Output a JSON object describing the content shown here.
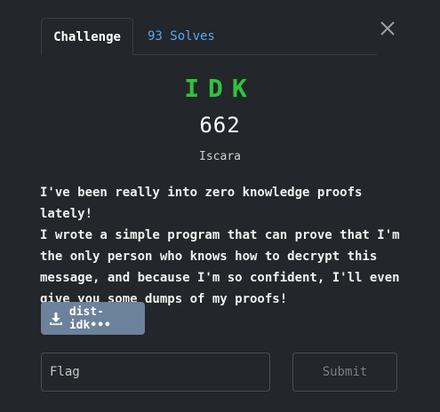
{
  "tabs": [
    {
      "label": "Challenge",
      "active": true
    },
    {
      "label": "93 Solves",
      "active": false
    }
  ],
  "challenge": {
    "name": "IDK",
    "points": "662",
    "author": "Iscara",
    "description_lines": [
      "I've been really into zero knowledge proofs lately!",
      "I wrote a simple program that can prove that I'm",
      "the only person who knows how to decrypt this",
      "message, and because I'm so confident, I'll even",
      "give you some dumps of my proofs!"
    ],
    "file_label": "dist-idk•••"
  },
  "flag_form": {
    "placeholder": "Flag",
    "submit_label": "Submit"
  },
  "colors": {
    "background": "#23262a",
    "title": "#2ec43f",
    "solves_link": "#5aa6f2",
    "file_button": "#6c819b"
  },
  "icons": {
    "close": "close-icon",
    "download": "download-icon"
  }
}
